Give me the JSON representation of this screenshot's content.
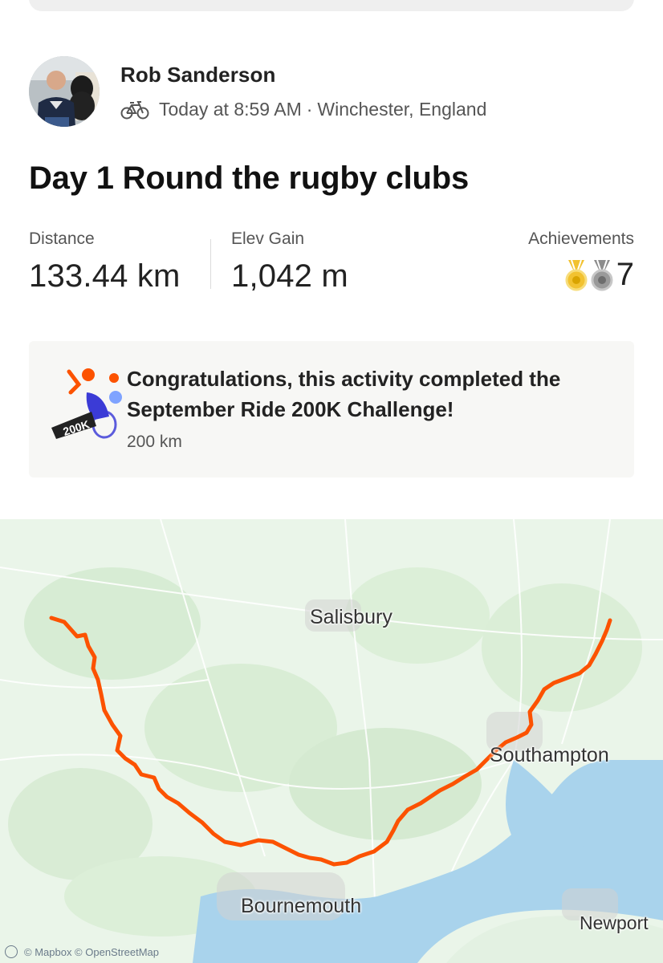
{
  "athlete": {
    "name": "Rob Sanderson",
    "time": "Today at 8:59 AM",
    "separator": "·",
    "location": "Winchester, England"
  },
  "activity": {
    "title": "Day 1 Round the rugby clubs",
    "sport_icon": "bike-icon"
  },
  "stats": {
    "distance": {
      "label": "Distance",
      "value": "133.44 km"
    },
    "elev_gain": {
      "label": "Elev Gain",
      "value": "1,042 m"
    },
    "achievements": {
      "label": "Achievements",
      "count": "7",
      "icons": [
        "gold-medal-icon",
        "silver-medal-icon"
      ]
    }
  },
  "challenge": {
    "badge_text": "200K",
    "message": "Congratulations, this activity completed the September Ride 200K Challenge!",
    "distance": "200 km"
  },
  "map": {
    "labels": {
      "salisbury": "Salisbury",
      "southampton": "Southampton",
      "bournemouth": "Bournemouth",
      "newport": "Newport"
    },
    "attribution": "© Mapbox © OpenStreetMap",
    "route_color": "#fc5200",
    "water_color": "#a9d3ec",
    "land_color": "#e9f4e8"
  }
}
